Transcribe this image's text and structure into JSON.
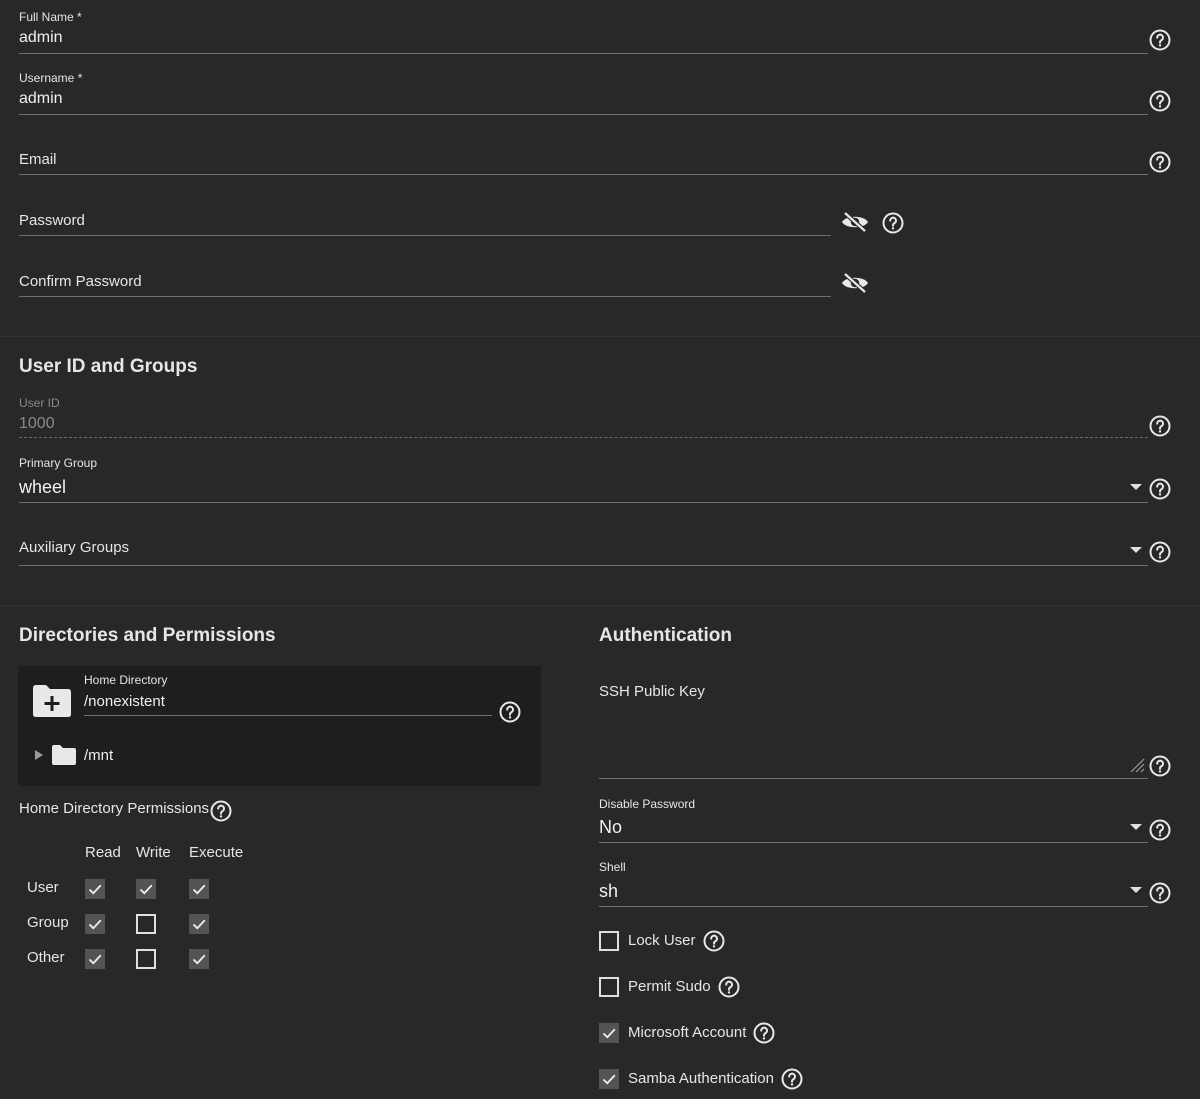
{
  "identity": {
    "full_name": {
      "label": "Full Name *",
      "value": "admin"
    },
    "username": {
      "label": "Username *",
      "value": "admin"
    },
    "email": {
      "placeholder": "Email"
    },
    "password": {
      "placeholder": "Password"
    },
    "confirm_password": {
      "placeholder": "Confirm Password"
    }
  },
  "user_id_groups": {
    "title": "User ID and Groups",
    "user_id": {
      "label": "User ID",
      "value": "1000"
    },
    "primary_group": {
      "label": "Primary Group",
      "value": "wheel"
    },
    "auxiliary_groups": {
      "placeholder": "Auxiliary Groups"
    }
  },
  "directories": {
    "title": "Directories and Permissions",
    "home_directory": {
      "label": "Home Directory",
      "value": "/nonexistent"
    },
    "tree_root": "/mnt",
    "permissions_label": "Home Directory Permissions",
    "columns": [
      "Read",
      "Write",
      "Execute"
    ],
    "rows": [
      {
        "name": "User",
        "read": true,
        "write": true,
        "execute": true
      },
      {
        "name": "Group",
        "read": true,
        "write": false,
        "execute": true
      },
      {
        "name": "Other",
        "read": true,
        "write": false,
        "execute": true
      }
    ]
  },
  "authentication": {
    "title": "Authentication",
    "ssh_key": {
      "placeholder": "SSH Public Key"
    },
    "disable_password": {
      "label": "Disable Password",
      "value": "No"
    },
    "shell": {
      "label": "Shell",
      "value": "sh"
    },
    "options": [
      {
        "label": "Lock User",
        "checked": false
      },
      {
        "label": "Permit Sudo",
        "checked": false
      },
      {
        "label": "Microsoft Account",
        "checked": true
      },
      {
        "label": "Samba Authentication",
        "checked": true
      }
    ]
  },
  "colors": {
    "background": "#282828",
    "explorer_background": "#1e1e1e",
    "checkbox_checked": "#545454",
    "text": "#e6e6e6"
  }
}
